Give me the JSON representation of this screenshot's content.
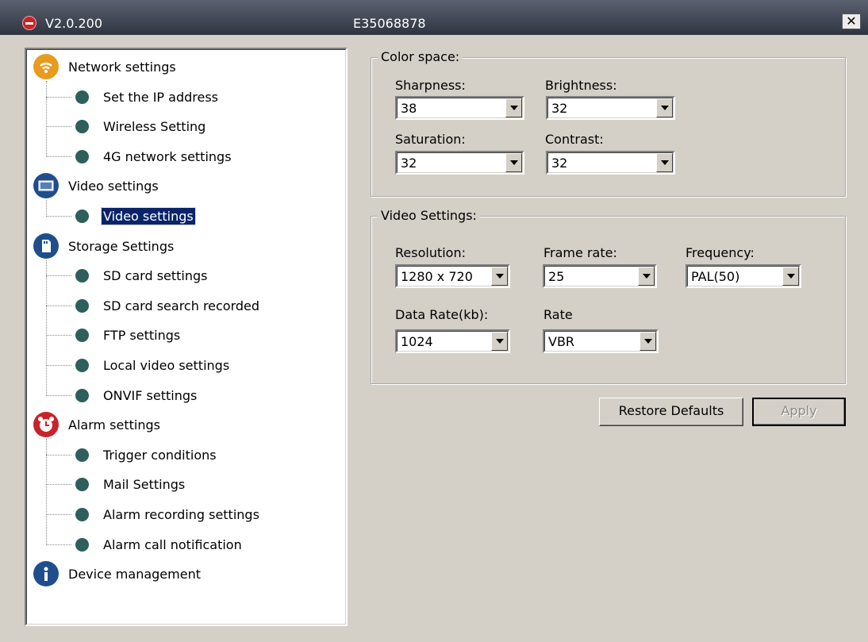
{
  "window": {
    "version": "V2.0.200",
    "device_id": "E35068878",
    "close_glyph": "✕"
  },
  "tree": [
    {
      "label": "Network settings",
      "icon": "wifi-icon",
      "color": "#e89b1c",
      "children": [
        "Set the IP address",
        "Wireless Setting",
        "4G network settings"
      ]
    },
    {
      "label": "Video settings",
      "icon": "monitor-icon",
      "color": "#1f4e8c",
      "children": [
        "Video settings"
      ]
    },
    {
      "label": "Storage Settings",
      "icon": "sd-card-icon",
      "color": "#1f4e8c",
      "children": [
        "SD card settings",
        "SD card search recorded",
        "FTP settings",
        "Local video settings",
        "ONVIF settings"
      ]
    },
    {
      "label": "Alarm settings",
      "icon": "alarm-clock-icon",
      "color": "#c8232a",
      "children": [
        "Trigger conditions",
        "Mail Settings",
        "Alarm recording settings",
        "Alarm call notification"
      ]
    },
    {
      "label": "Device management",
      "icon": "info-icon",
      "color": "#1f4e8c",
      "children": []
    }
  ],
  "selected_item": "Video settings",
  "color_space": {
    "title": "Color space:",
    "sharpness": {
      "label": "Sharpness:",
      "value": "38"
    },
    "brightness": {
      "label": "Brightness:",
      "value": "32"
    },
    "saturation": {
      "label": "Saturation:",
      "value": "32"
    },
    "contrast": {
      "label": "Contrast:",
      "value": "32"
    }
  },
  "video_settings": {
    "title": "Video Settings:",
    "resolution": {
      "label": "Resolution:",
      "value": "1280 x 720"
    },
    "frame_rate": {
      "label": "Frame rate:",
      "value": "25"
    },
    "frequency": {
      "label": "Frequency:",
      "value": "PAL(50)"
    },
    "data_rate": {
      "label": "Data Rate(kb):",
      "value": "1024"
    },
    "rate": {
      "label": "Rate",
      "value": "VBR"
    }
  },
  "buttons": {
    "restore": "Restore Defaults",
    "apply": "Apply"
  }
}
